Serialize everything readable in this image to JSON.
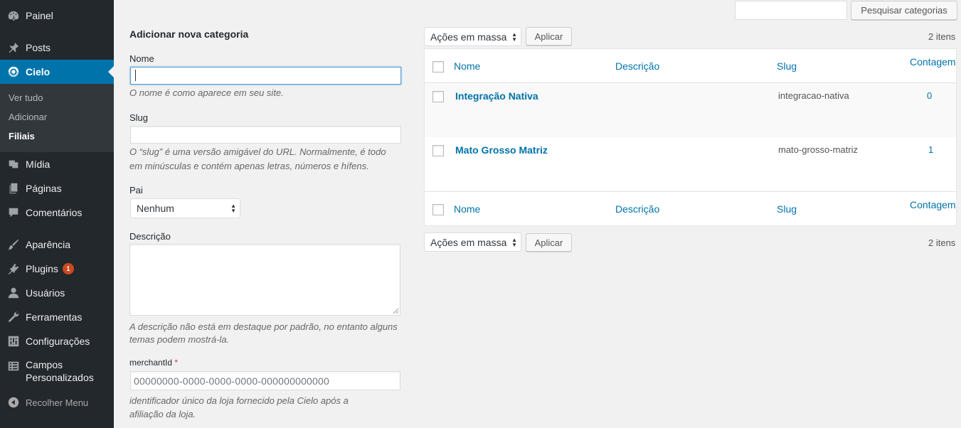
{
  "sidebar": {
    "items": [
      {
        "label": "Painel",
        "icon": "dashboard-icon"
      },
      {
        "label": "Posts",
        "icon": "pin-icon"
      },
      {
        "label": "Cielo",
        "icon": "cielo-icon"
      },
      {
        "label": "Mídia",
        "icon": "media-icon"
      },
      {
        "label": "Páginas",
        "icon": "pages-icon"
      },
      {
        "label": "Comentários",
        "icon": "comment-icon"
      },
      {
        "label": "Aparência",
        "icon": "brush-icon"
      },
      {
        "label": "Plugins",
        "icon": "plugin-icon",
        "badge": "1"
      },
      {
        "label": "Usuários",
        "icon": "user-icon"
      },
      {
        "label": "Ferramentas",
        "icon": "wrench-icon"
      },
      {
        "label": "Configurações",
        "icon": "settings-icon"
      },
      {
        "label_line1": "Campos",
        "label_line2": "Personalizados",
        "icon": "grid-icon"
      }
    ],
    "submenu": [
      "Ver tudo",
      "Adicionar",
      "Filiais"
    ],
    "collapse_label": "Recolher Menu"
  },
  "search": {
    "value": "",
    "button_label": "Pesquisar categorias"
  },
  "form": {
    "title": "Adicionar nova categoria",
    "name_label": "Nome",
    "name_help": "O nome é como aparece em seu site.",
    "slug_label": "Slug",
    "slug_help_1": "O “slug” é uma versão amigável do URL. Normalmente, é todo",
    "slug_help_2": "em minúsculas e contém apenas letras, números e hífens.",
    "parent_label": "Pai",
    "parent_selected": "Nenhum",
    "desc_label": "Descrição",
    "desc_help_1": "A descrição não está em destaque por padrão, no entanto alguns",
    "desc_help_2": "temas podem mostrá-la.",
    "merchant_label": "merchantId",
    "merchant_required": "*",
    "merchant_placeholder": "00000000-0000-0000-0000-000000000000",
    "merchant_help_1": "identificador único da loja fornecido pela Cielo após a",
    "merchant_help_2": "afiliação da loja."
  },
  "bulk": {
    "selected": "Ações em massa",
    "apply_label": "Aplicar",
    "items_count": "2 itens"
  },
  "table": {
    "headers": {
      "name": "Nome",
      "description": "Descrição",
      "slug": "Slug",
      "count": "Contagem"
    },
    "rows": [
      {
        "name": "Integração Nativa",
        "description": "",
        "slug": "integracao-nativa",
        "count": "0"
      },
      {
        "name": "Mato Grosso Matriz",
        "description": "",
        "slug": "mato-grosso-matriz",
        "count": "1"
      }
    ]
  },
  "colors": {
    "sidebar_bg": "#23282d",
    "active_bg": "#0073aa",
    "link": "#0073aa",
    "badge": "#ca4a1f"
  }
}
